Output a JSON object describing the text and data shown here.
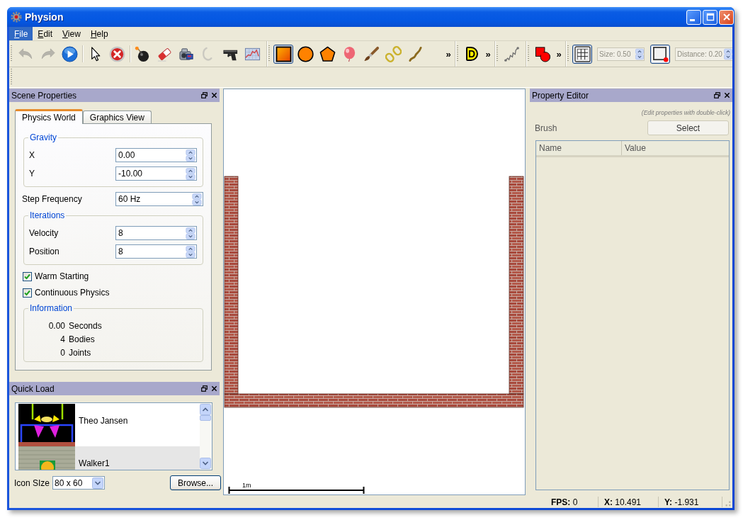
{
  "window": {
    "title": "Physion"
  },
  "menu": [
    {
      "label": "File",
      "selected": true
    },
    {
      "label": "Edit",
      "selected": false
    },
    {
      "label": "View",
      "selected": false
    },
    {
      "label": "Help",
      "selected": false
    }
  ],
  "toolbar": {
    "groups": [
      {
        "items": [
          {
            "kind": "tool",
            "disabled": true,
            "selected": false
          },
          {
            "kind": "tool",
            "disabled": true,
            "selected": false
          },
          {
            "kind": "tool",
            "disabled": false,
            "selected": false
          },
          {
            "kind": "separator"
          },
          {
            "kind": "tool",
            "disabled": false,
            "selected": false
          },
          {
            "kind": "tool",
            "disabled": false,
            "selected": false
          },
          {
            "kind": "separator"
          },
          {
            "kind": "tool",
            "disabled": false,
            "selected": false
          },
          {
            "kind": "tool",
            "disabled": false,
            "selected": false
          },
          {
            "kind": "tool",
            "disabled": false,
            "selected": false
          },
          {
            "kind": "tool",
            "disabled": true,
            "selected": false
          },
          {
            "kind": "tool",
            "disabled": false,
            "selected": false
          },
          {
            "kind": "tool",
            "disabled": false,
            "selected": false
          }
        ]
      },
      {
        "items": [
          {
            "kind": "tool",
            "disabled": false,
            "selected": true
          },
          {
            "kind": "tool",
            "disabled": false,
            "selected": false
          },
          {
            "kind": "tool",
            "disabled": false,
            "selected": false
          },
          {
            "kind": "tool",
            "disabled": false,
            "selected": false
          },
          {
            "kind": "tool",
            "disabled": false,
            "selected": false
          },
          {
            "kind": "tool",
            "disabled": false,
            "selected": false
          },
          {
            "kind": "tool",
            "disabled": false,
            "selected": false
          },
          {
            "kind": "overflow",
            "label": "»"
          }
        ]
      },
      {
        "items": [
          {
            "kind": "tool",
            "glyph": "D",
            "disabled": false,
            "selected": false
          },
          {
            "kind": "overflow",
            "label": "»"
          }
        ]
      },
      {
        "items": [
          {
            "kind": "tool",
            "disabled": false,
            "selected": false
          }
        ]
      },
      {
        "items": [
          {
            "kind": "tool",
            "disabled": false,
            "selected": false
          },
          {
            "kind": "overflow",
            "label": "»"
          }
        ]
      },
      {
        "items": [
          {
            "kind": "tool",
            "disabled": false,
            "selected": true
          },
          {
            "kind": "spin",
            "value": "Size: 0.50",
            "disabled": true
          },
          {
            "kind": "tool",
            "disabled": false,
            "selected": true
          },
          {
            "kind": "spin",
            "value": "Distance: 0.20",
            "disabled": true
          }
        ]
      }
    ]
  },
  "scene_properties": {
    "title": "Scene Properties",
    "tabs": [
      {
        "label": "Physics World",
        "selected": true
      },
      {
        "label": "Graphics View",
        "selected": false
      }
    ],
    "gravity": {
      "title": "Gravity",
      "fields": [
        {
          "label": "X",
          "value": "0.00"
        },
        {
          "label": "Y",
          "value": "-10.00"
        }
      ]
    },
    "step_frequency": {
      "label": "Step Frequency",
      "value": "60 Hz"
    },
    "iterations": {
      "title": "Iterations",
      "fields": [
        {
          "label": "Velocity",
          "value": "8"
        },
        {
          "label": "Position",
          "value": "8"
        }
      ]
    },
    "options": [
      {
        "label": "Warm Starting",
        "checked": true
      },
      {
        "label": "Continuous Physics",
        "checked": true
      }
    ],
    "information": {
      "title": "Information",
      "rows": [
        {
          "amount": "0.00",
          "unit": "Seconds"
        },
        {
          "amount": "4",
          "unit": "Bodies"
        },
        {
          "amount": "0",
          "unit": "Joints"
        }
      ]
    }
  },
  "quick_load": {
    "title": "Quick Load",
    "items": [
      {
        "label": "Theo Jansen"
      },
      {
        "label": "Walker1"
      }
    ],
    "icon_size": {
      "label": "Icon SIze",
      "value": "80 x 60"
    },
    "browse_button": "Browse..."
  },
  "canvas": {
    "scale_label": "1m"
  },
  "property_editor": {
    "title": "Property Editor",
    "hint": "(Edit properties with double-click)",
    "brush_label": "Brush",
    "select_button": "Select",
    "columns": [
      "Name",
      "Value"
    ]
  },
  "status_bar": [
    {
      "text": "**FPS:** 0"
    },
    {
      "text": "**X:** 10.491"
    },
    {
      "text": "**Y:** -1.931"
    }
  ]
}
